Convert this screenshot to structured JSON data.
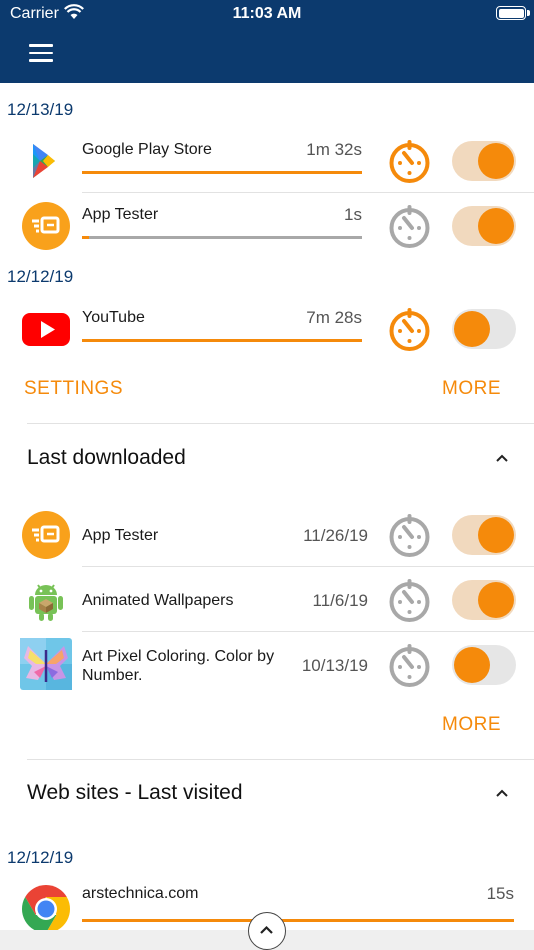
{
  "status_bar": {
    "carrier": "Carrier",
    "time": "11:03 AM"
  },
  "colors": {
    "accent": "#f58a0b",
    "header": "#0c3a6e",
    "date": "#0c3a6e"
  },
  "recent": {
    "groups": [
      {
        "date": "12/13/19",
        "items": [
          {
            "name": "Google Play Store",
            "duration": "1m 32s",
            "icon": "google-play-icon",
            "toggle": "on",
            "timer_active": true
          },
          {
            "name": "App Tester",
            "duration": "1s",
            "icon": "app-tester-icon",
            "toggle": "on",
            "timer_active": false
          }
        ]
      },
      {
        "date": "12/12/19",
        "items": [
          {
            "name": "YouTube",
            "duration": "7m 28s",
            "icon": "youtube-icon",
            "toggle": "off",
            "timer_active": true
          }
        ]
      }
    ],
    "settings_label": "SETTINGS",
    "more_label": "MORE"
  },
  "last_downloaded": {
    "title": "Last downloaded",
    "items": [
      {
        "name": "App Tester",
        "date": "11/26/19",
        "icon": "app-tester-icon",
        "toggle": "on"
      },
      {
        "name": "Animated Wallpapers",
        "date": "11/6/19",
        "icon": "android-icon",
        "toggle": "on"
      },
      {
        "name": "Art Pixel Coloring. Color by Number.",
        "date": "10/13/19",
        "icon": "butterfly-icon",
        "toggle": "off"
      }
    ],
    "more_label": "MORE"
  },
  "web_sites": {
    "title": "Web sites - Last visited",
    "date": "12/12/19",
    "items": [
      {
        "name": "arstechnica.com",
        "duration": "15s",
        "icon": "chrome-icon"
      }
    ]
  }
}
